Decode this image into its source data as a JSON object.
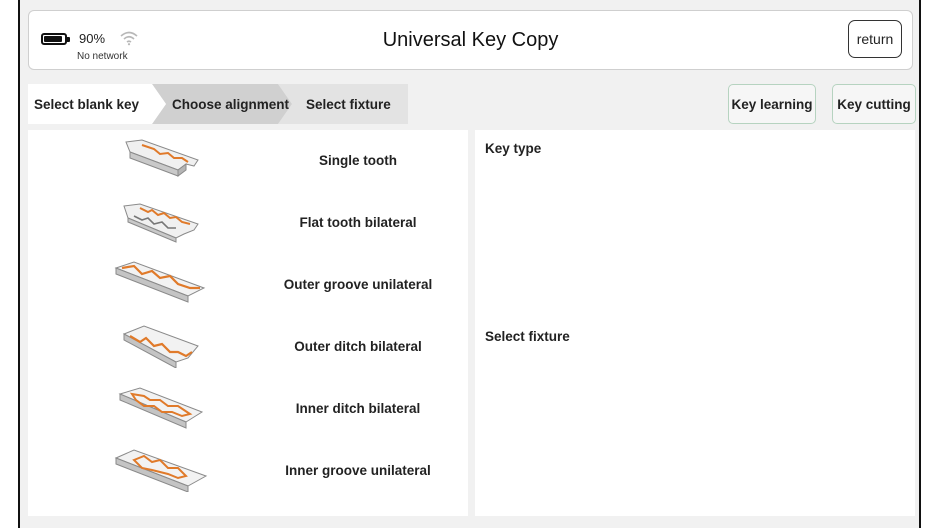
{
  "status": {
    "battery_pct": "90%",
    "battery_level": 0.9,
    "network": "No network"
  },
  "header": {
    "title": "Universal Key Copy",
    "return_label": "return"
  },
  "steps": [
    "Select blank key",
    "Choose alignment",
    "Select fixture"
  ],
  "actions": {
    "learning": "Key learning",
    "cutting": "Key cutting"
  },
  "key_types": [
    {
      "label": "Single tooth",
      "icon": "single-tooth-key-icon"
    },
    {
      "label": "Flat tooth bilateral",
      "icon": "flat-tooth-bilateral-key-icon"
    },
    {
      "label": "Outer groove unilateral",
      "icon": "outer-groove-unilateral-key-icon"
    },
    {
      "label": "Outer ditch bilateral",
      "icon": "outer-ditch-bilateral-key-icon"
    },
    {
      "label": "Inner ditch bilateral",
      "icon": "inner-ditch-bilateral-key-icon"
    },
    {
      "label": "Inner groove unilateral",
      "icon": "inner-groove-unilateral-key-icon"
    }
  ],
  "right": {
    "key_type_label": "Key type",
    "fixture_label": "Select fixture"
  },
  "colors": {
    "accent_orange": "#e07a2a",
    "button_border": "#b6d3c0",
    "step_active": "#d0d0d0"
  }
}
